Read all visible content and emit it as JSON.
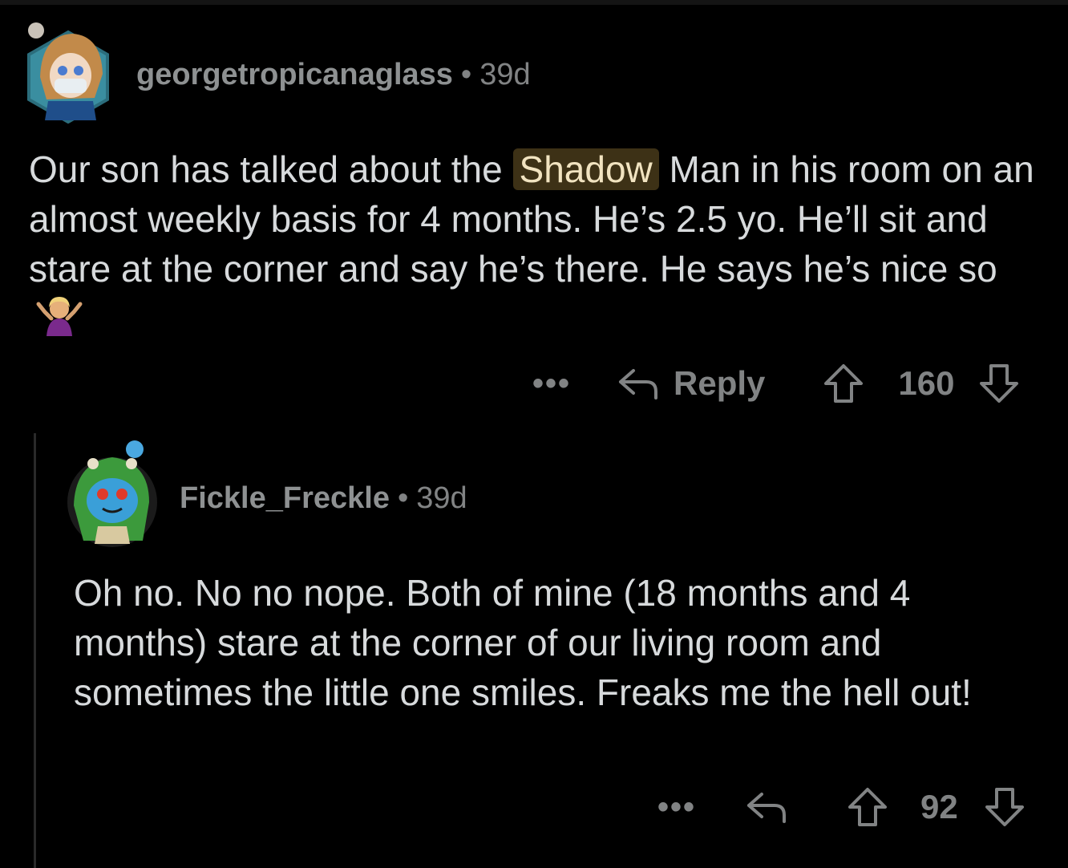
{
  "comments": [
    {
      "username": "georgetropicanaglass",
      "separator": "•",
      "age": "39d",
      "body_before": "Our son has talked about the ",
      "highlight": "Shadow",
      "body_after": " Man in his room on an almost weekly basis for 4 months. He’s 2.5 yo. He’ll sit and stare at the corner and say he’s there. He says he’s nice so",
      "emoji_name": "person-shrugging-emoji",
      "more_label": "•••",
      "reply_label": "Reply",
      "score": "160"
    },
    {
      "username": "Fickle_Freckle",
      "separator": "•",
      "age": "39d",
      "body": "Oh no. No no nope. Both of mine (18 months and 4 months) stare at the corner of our living room and sometimes the little one smiles. Freaks me the hell out!",
      "more_label": "•••",
      "score": "92"
    }
  ],
  "colors": {
    "background": "#000000",
    "text": "#d7dadc",
    "meta": "#818384",
    "highlight_bg": "#3d3116"
  }
}
